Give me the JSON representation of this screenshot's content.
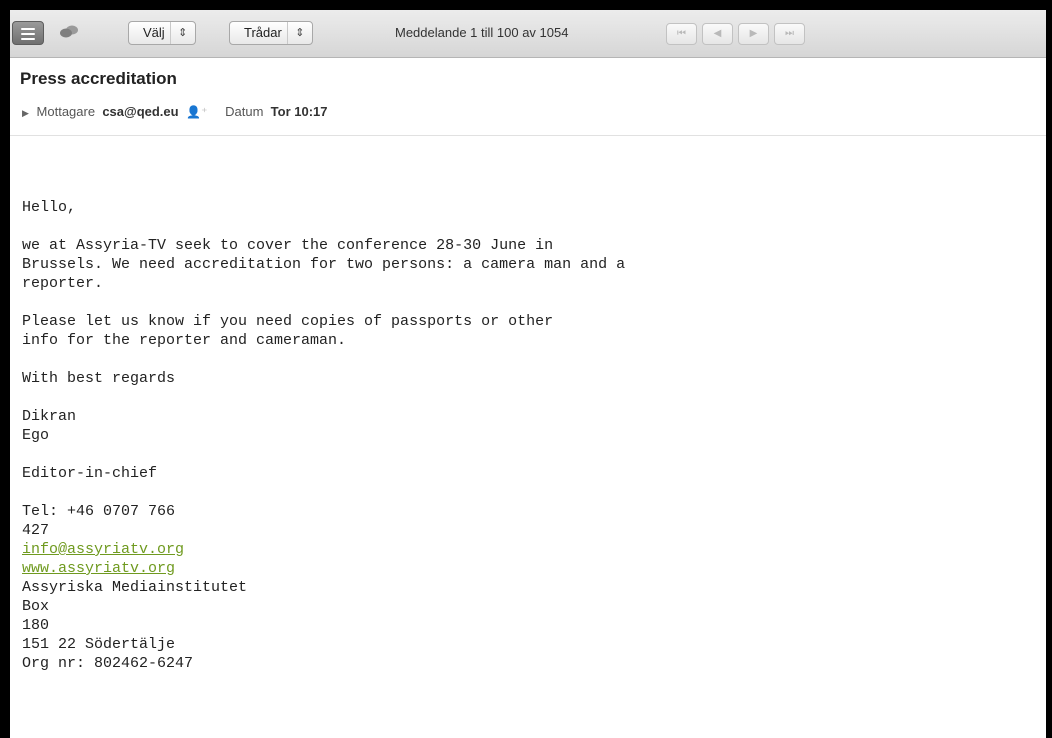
{
  "toolbar": {
    "view_select": "Välj",
    "thread_select": "Trådar",
    "message_counter": "Meddelande 1 till 100 av 1054",
    "nav_first": "⏮",
    "nav_prev": "◀",
    "nav_next": "▶",
    "nav_last": "⏭"
  },
  "message": {
    "subject": "Press accreditation",
    "recipient_label": "Mottagare",
    "recipient": "csa@qed.eu",
    "date_label": "Datum",
    "date": "Tor 10:17"
  },
  "body": {
    "greeting": "Hello,",
    "p1_lines": [
      "we at Assyria-TV seek to cover the conference 28-30 June in",
      "Brussels. We need accreditation for two persons: a camera man and a",
      "reporter."
    ],
    "p2_lines": [
      "Please let us know if you need copies of passports or other",
      "info for the reporter and cameraman."
    ],
    "closing": "With best regards",
    "name_first": "Dikran",
    "name_last": "Ego",
    "title": "Editor-in-chief",
    "tel_line1": "Tel: +46 0707 766",
    "tel_line2": "427",
    "email_link": "info@assyriatv.org",
    "web_link": "www.assyriatv.org",
    "org_name": "Assyriska Mediainstitutet",
    "box_line1": "Box",
    "box_line2": "180",
    "city": "151 22 Södertälje",
    "org_nr": "Org nr: 802462-6247"
  }
}
